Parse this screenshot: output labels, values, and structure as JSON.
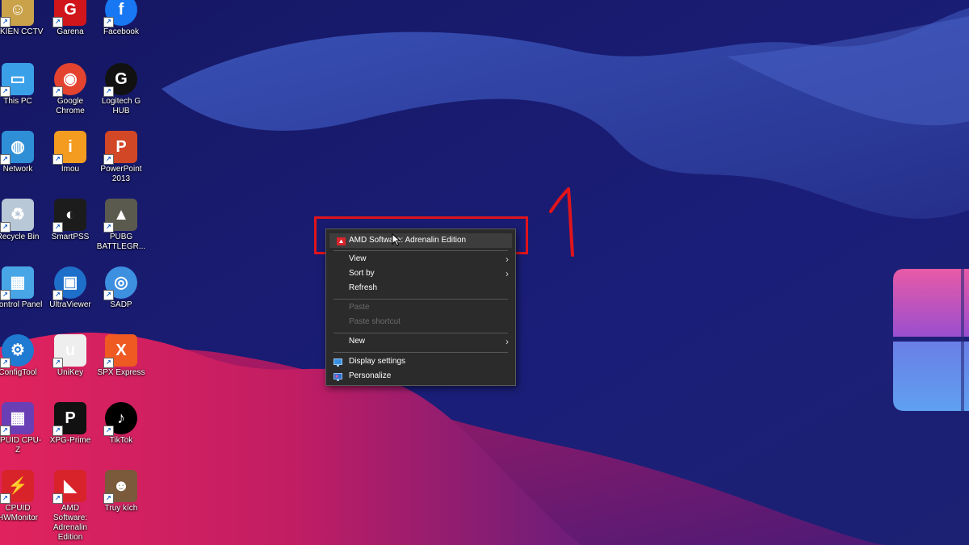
{
  "desktop_icons": [
    {
      "label": "E KIEN CCTV",
      "icon": "user-folder-icon",
      "color": "#c9a24a"
    },
    {
      "label": "Garena",
      "icon": "garena-icon",
      "color": "#d0151b"
    },
    {
      "label": "Facebook",
      "icon": "facebook-icon",
      "color": "#1877f2"
    },
    {
      "label": "This PC",
      "icon": "computer-icon",
      "color": "#3aa0e8"
    },
    {
      "label": "Google Chrome",
      "icon": "chrome-icon",
      "color": "#e3432f"
    },
    {
      "label": "Logitech G HUB",
      "icon": "logitech-icon",
      "color": "#111111"
    },
    {
      "label": "Network",
      "icon": "network-icon",
      "color": "#2f8fd6"
    },
    {
      "label": "Imou",
      "icon": "imou-icon",
      "color": "#f39c1f"
    },
    {
      "label": "PowerPoint 2013",
      "icon": "powerpoint-icon",
      "color": "#d24726"
    },
    {
      "label": "Recycle Bin",
      "icon": "recycle-bin-icon",
      "color": "#b9c8d6"
    },
    {
      "label": "SmartPSS",
      "icon": "smartpss-icon",
      "color": "#1c1c1c"
    },
    {
      "label": "PUBG BATTLEGR...",
      "icon": "pubg-icon",
      "color": "#5b5a4e"
    },
    {
      "label": "Control Panel",
      "icon": "control-panel-icon",
      "color": "#49a6e6"
    },
    {
      "label": "UltraViewer",
      "icon": "ultraviewer-icon",
      "color": "#1e6fc9"
    },
    {
      "label": "SADP",
      "icon": "sadp-icon",
      "color": "#3d8fe0"
    },
    {
      "label": "ConfigTool",
      "icon": "configtool-icon",
      "color": "#1f7ad1"
    },
    {
      "label": "UniKey",
      "icon": "unikey-icon",
      "color": "#eeeeee"
    },
    {
      "label": "SPX Express",
      "icon": "spx-express-icon",
      "color": "#ee5a22"
    },
    {
      "label": "CPUID CPU-Z",
      "icon": "cpuz-icon",
      "color": "#6a3fb5"
    },
    {
      "label": "XPG-Prime",
      "icon": "xpg-prime-icon",
      "color": "#111111"
    },
    {
      "label": "TikTok",
      "icon": "tiktok-icon",
      "color": "#000000"
    },
    {
      "label": "CPUID HWMonitor",
      "icon": "hwmonitor-icon",
      "color": "#d8232a"
    },
    {
      "label": "AMD Software: Adrenalin Edition",
      "icon": "amd-icon",
      "color": "#d8232a"
    },
    {
      "label": "Truy kích",
      "icon": "truy-kich-icon",
      "color": "#7a5a3a"
    }
  ],
  "context_menu": {
    "items": [
      {
        "label": "AMD Software: Adrenalin Edition",
        "icon": "amd-icon",
        "enabled": true,
        "hover": true
      },
      {
        "label": "View",
        "submenu": true,
        "enabled": true
      },
      {
        "label": "Sort by",
        "submenu": true,
        "enabled": true
      },
      {
        "label": "Refresh",
        "enabled": true
      },
      {
        "label": "Paste",
        "enabled": false
      },
      {
        "label": "Paste shortcut",
        "enabled": false
      },
      {
        "label": "New",
        "submenu": true,
        "enabled": true
      },
      {
        "label": "Display settings",
        "icon": "display-icon",
        "enabled": true
      },
      {
        "label": "Personalize",
        "icon": "personalize-icon",
        "enabled": true
      }
    ],
    "submenu_arrow": "›"
  },
  "annotation": {
    "step_label": "1",
    "color": "#e0141b"
  },
  "colors": {
    "wallpaper_base": "#1a1b6e",
    "wave_magenta": "#d0205f",
    "wave_blue": "#3a4fb0",
    "menu_bg": "#2b2b2b"
  }
}
